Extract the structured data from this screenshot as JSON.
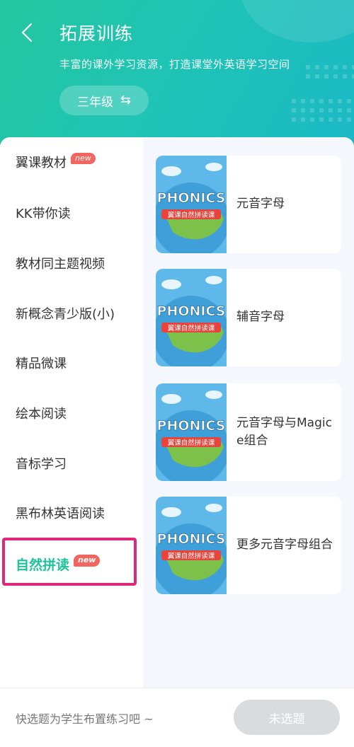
{
  "header": {
    "title": "拓展训练",
    "subtitle": "丰富的课外学习资源，打造课堂外英语学习空间",
    "grade": "三年级",
    "swap_icon": "⇆"
  },
  "sidebar": {
    "items": [
      {
        "label": "翼课教材",
        "badge": "new"
      },
      {
        "label": "KK带你读"
      },
      {
        "label": "教材同主题视频"
      },
      {
        "label": "新概念青少版(小)"
      },
      {
        "label": "精品微课"
      },
      {
        "label": "绘本阅读"
      },
      {
        "label": "音标学习"
      },
      {
        "label": "黑布林英语阅读"
      },
      {
        "label": "自然拼读",
        "badge": "new",
        "active": true
      }
    ]
  },
  "cards": [
    {
      "title": "元音字母",
      "thumb_title": "PHONICS",
      "thumb_sub": "翼课自然拼读课"
    },
    {
      "title": "辅音字母",
      "thumb_title": "PHONICS",
      "thumb_sub": "翼课自然拼读课"
    },
    {
      "title": "元音字母与Magic e组合",
      "thumb_title": "PHONICS",
      "thumb_sub": "翼课自然拼读课"
    },
    {
      "title": "更多元音字母组合",
      "thumb_title": "PHONICS",
      "thumb_sub": "翼课自然拼读课"
    }
  ],
  "footer": {
    "hint": "快选题为学生布置练习吧 ~",
    "button": "未选题"
  },
  "colors": {
    "accent": "#1ec39b",
    "badge": "#f2665f",
    "highlight": "#e0287a",
    "disabled_button": "#d9dcdf"
  }
}
